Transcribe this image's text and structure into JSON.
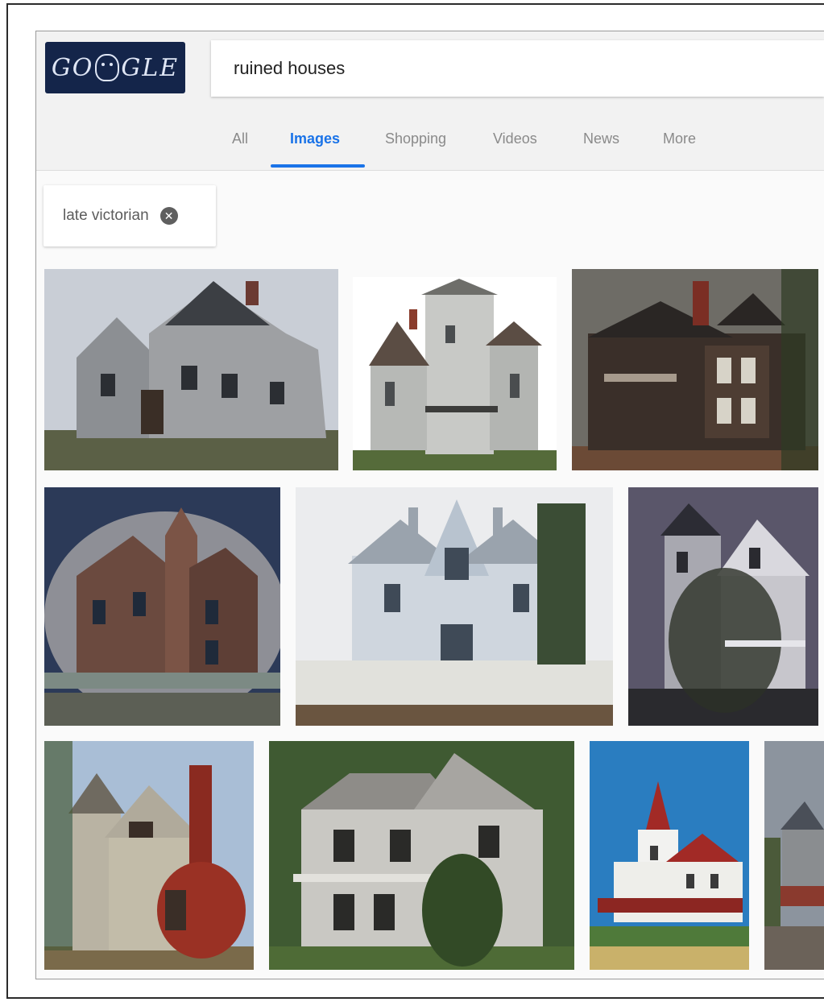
{
  "logo": {
    "text_left": "GO",
    "text_right": "GLE"
  },
  "search": {
    "query": "ruined houses"
  },
  "tabs": [
    {
      "label": "All"
    },
    {
      "label": "Images"
    },
    {
      "label": "Shopping"
    },
    {
      "label": "Videos"
    },
    {
      "label": "News"
    },
    {
      "label": "More"
    }
  ],
  "active_tab": "Images",
  "filter_chip": {
    "label": "late victorian",
    "close_icon": "close-circle-icon"
  },
  "colors": {
    "accent": "#1a73e8",
    "logo_bg": "#14254a",
    "tab_inactive": "#8a8a8a"
  }
}
